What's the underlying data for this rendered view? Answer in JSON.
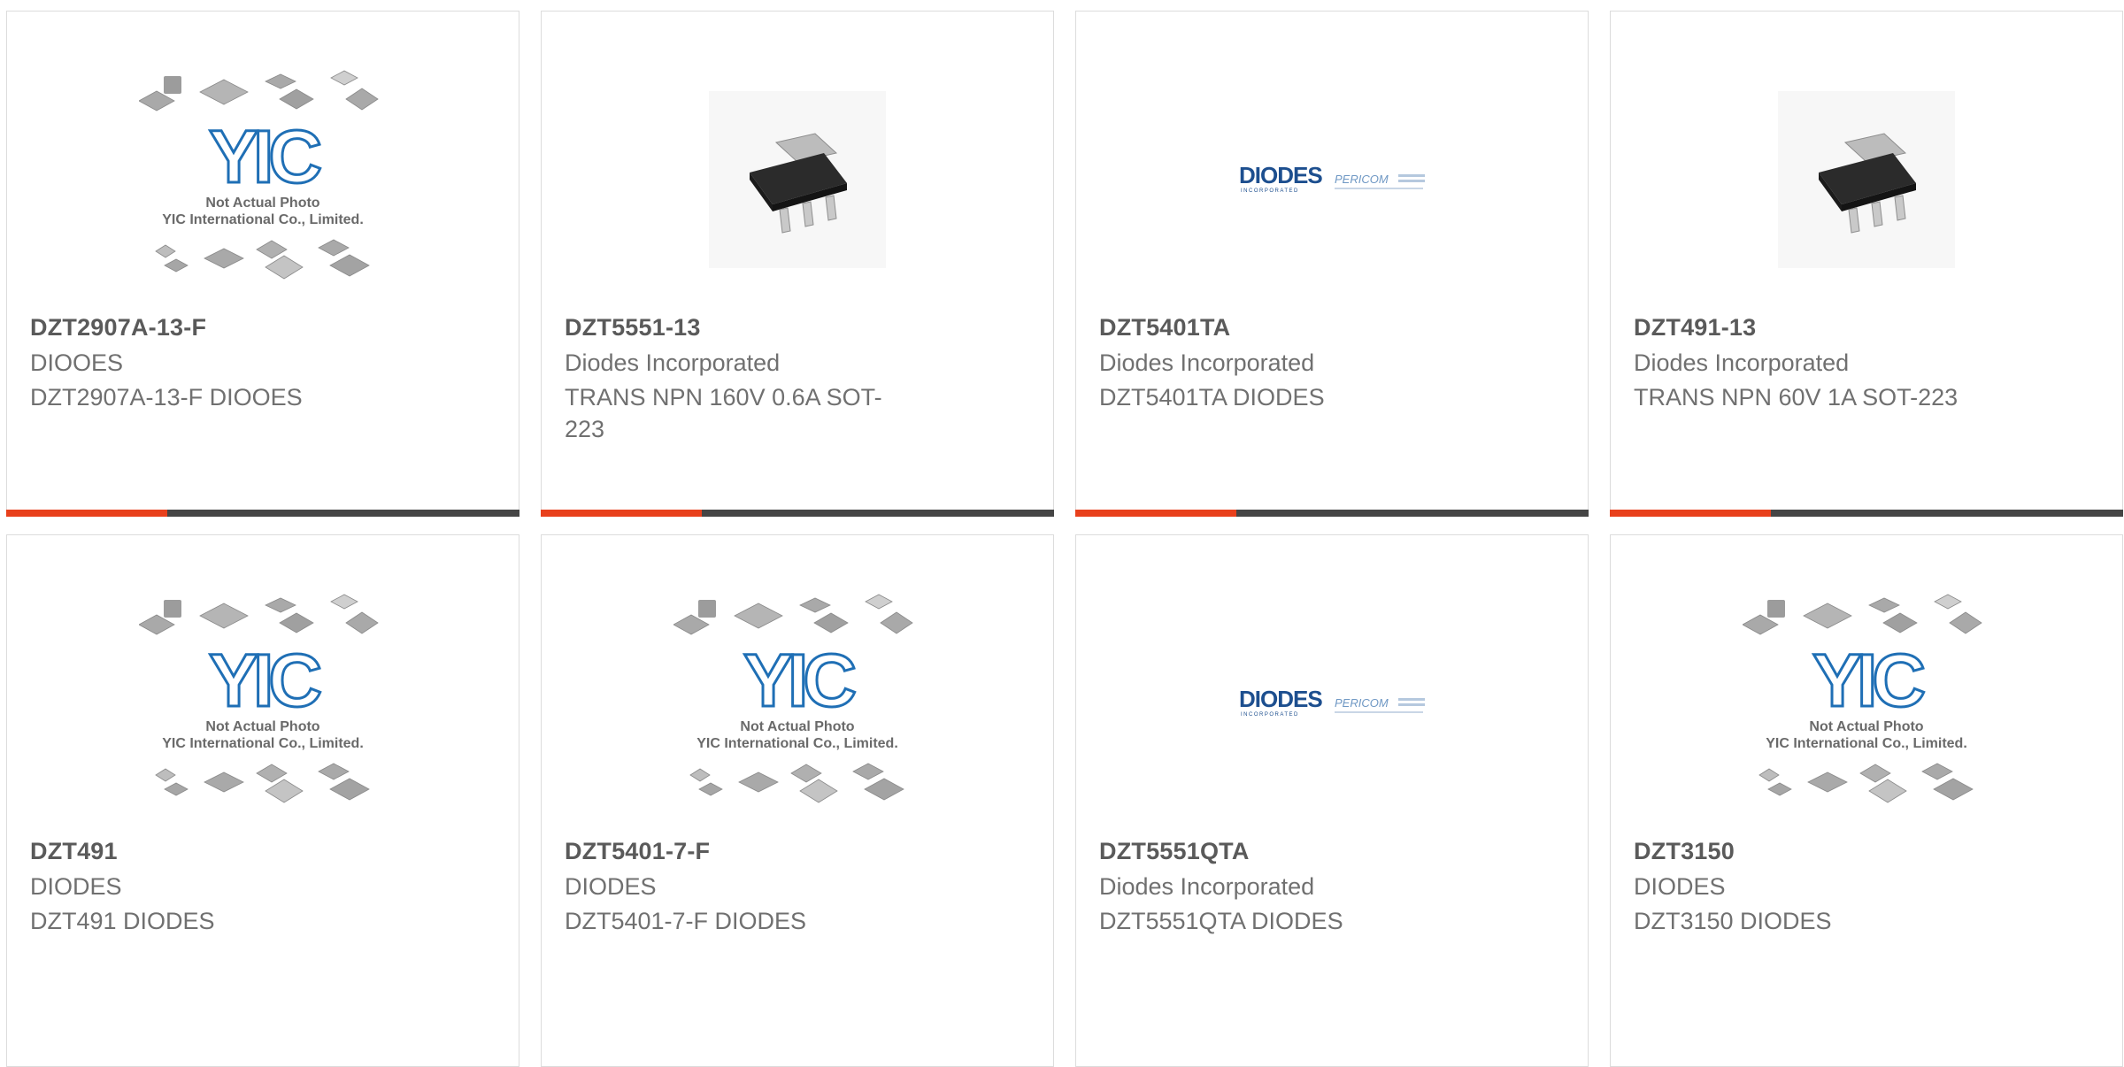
{
  "placeholder": {
    "line1": "Not Actual Photo",
    "line2": "YIC International Co., Limited.",
    "logo": "YIC"
  },
  "brand": {
    "diodes": "DIODES",
    "diodes_sub": "INCORPORATED",
    "pericom": "PERICOM"
  },
  "colors": {
    "accent": "#e8401c",
    "bar": "#454545",
    "yic_blue": "#1f6fb5"
  },
  "products": [
    {
      "part": "DZT2907A-13-F",
      "manufacturer": "DIOOES",
      "description": "DZT2907A-13-F DIOOES",
      "image": "yic-placeholder"
    },
    {
      "part": "DZT5551-13",
      "manufacturer": "Diodes Incorporated",
      "description": "TRANS NPN 160V 0.6A SOT-223",
      "image": "sot223-package"
    },
    {
      "part": "DZT5401TA",
      "manufacturer": "Diodes Incorporated",
      "description": "DZT5401TA DIODES",
      "image": "diodes-pericom-logo"
    },
    {
      "part": "DZT491-13",
      "manufacturer": "Diodes Incorporated",
      "description": "TRANS NPN 60V 1A SOT-223",
      "image": "sot223-package"
    },
    {
      "part": "DZT491",
      "manufacturer": "DIODES",
      "description": "DZT491 DIODES",
      "image": "yic-placeholder"
    },
    {
      "part": "DZT5401-7-F",
      "manufacturer": "DIODES",
      "description": "DZT5401-7-F DIODES",
      "image": "yic-placeholder"
    },
    {
      "part": "DZT5551QTA",
      "manufacturer": "Diodes Incorporated",
      "description": "DZT5551QTA DIODES",
      "image": "diodes-pericom-logo"
    },
    {
      "part": "DZT3150",
      "manufacturer": "DIODES",
      "description": "DZT3150 DIODES",
      "image": "yic-placeholder"
    }
  ]
}
